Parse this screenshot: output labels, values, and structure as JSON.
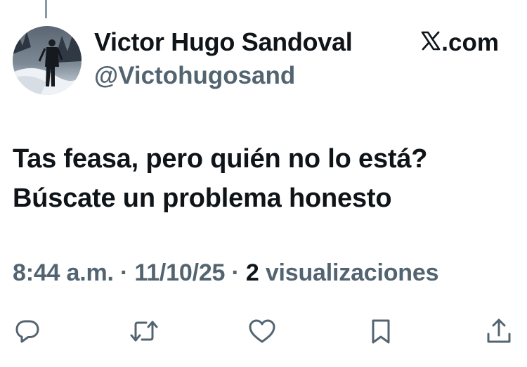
{
  "tweet": {
    "display_name": "Victor Hugo Sandoval",
    "handle": "@Victohugosand",
    "source_label": ".com",
    "text_lines": [
      "Tas feasa, pero quién no lo está?",
      "Búscate un problema honesto"
    ],
    "time": "8:44 a.m.",
    "date": "11/10/25",
    "separator": "·",
    "views_count": "2",
    "views_label": "visualizaciones"
  },
  "actions": [
    {
      "name": "reply",
      "icon": "reply-icon"
    },
    {
      "name": "repost",
      "icon": "repost-icon"
    },
    {
      "name": "like",
      "icon": "heart-icon"
    },
    {
      "name": "bookmark",
      "icon": "bookmark-icon"
    },
    {
      "name": "share",
      "icon": "share-icon"
    }
  ],
  "colors": {
    "text_primary": "#0f1419",
    "text_secondary": "#536471",
    "icon": "#536471",
    "background": "#ffffff"
  }
}
